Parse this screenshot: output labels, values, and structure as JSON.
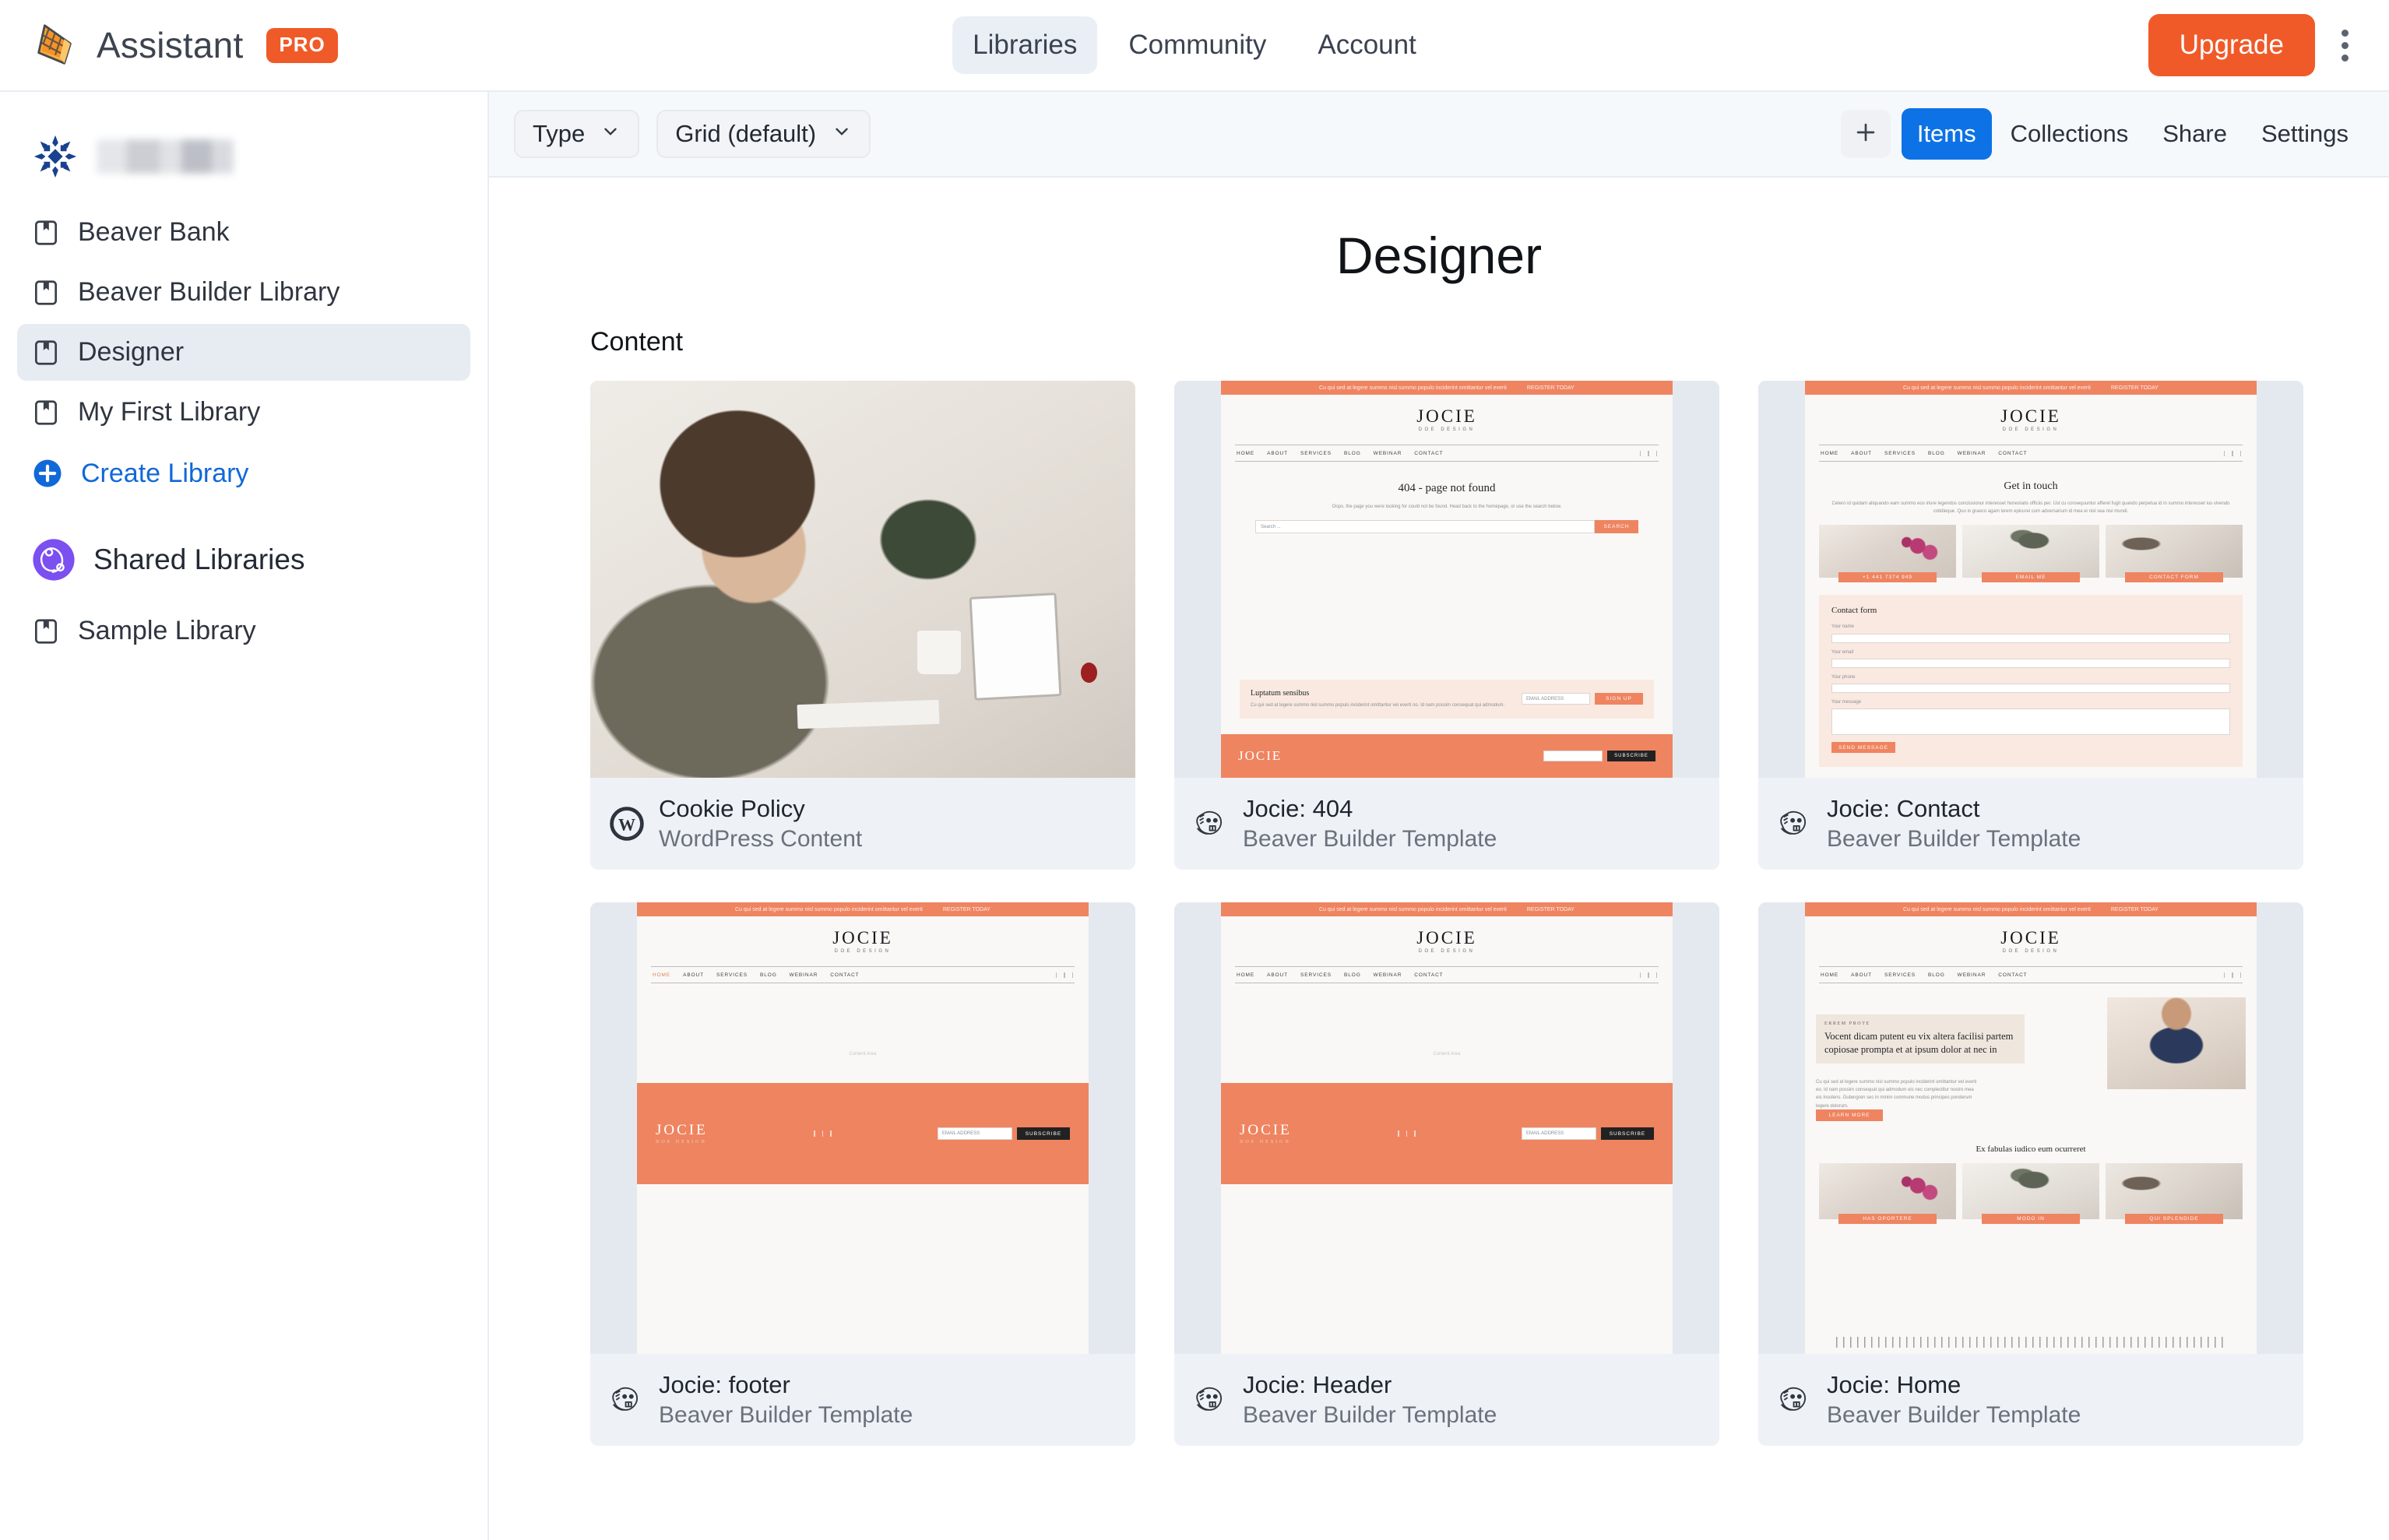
{
  "app": {
    "brand_name": "Assistant",
    "brand_badge": "PRO",
    "logo_icon": "beaver-tail-logo",
    "accent_orange": "#f05a28",
    "accent_blue": "#0d72e6",
    "link_blue": "#1168d8",
    "shared_purple": "#7b4ff0"
  },
  "topnav": {
    "items": [
      {
        "label": "Libraries",
        "active": true
      },
      {
        "label": "Community",
        "active": false
      },
      {
        "label": "Account",
        "active": false
      }
    ],
    "upgrade_label": "Upgrade",
    "kebab_icon": "more-vertical-icon"
  },
  "sidebar": {
    "team": {
      "logo_icon": "snowflake-team-logo",
      "name_redacted": true
    },
    "libraries": [
      {
        "label": "Beaver Bank",
        "icon": "library-bookmark-icon",
        "active": false
      },
      {
        "label": "Beaver Builder Library",
        "icon": "library-bookmark-icon",
        "active": false
      },
      {
        "label": "Designer",
        "icon": "library-bookmark-icon",
        "active": true
      },
      {
        "label": "My First Library",
        "icon": "library-bookmark-icon",
        "active": false
      }
    ],
    "create_label": "Create Library",
    "create_icon": "plus-circle-icon",
    "shared": {
      "heading": "Shared Libraries",
      "avatar_icon": "shared-libraries-avatar",
      "items": [
        {
          "label": "Sample Library",
          "icon": "library-bookmark-icon"
        }
      ]
    }
  },
  "toolbar": {
    "filters": [
      {
        "label": "Type",
        "icon": "chevron-down-icon"
      },
      {
        "label": "Grid (default)",
        "icon": "chevron-down-icon"
      }
    ],
    "add_icon": "plus-icon",
    "tabs": [
      {
        "label": "Items",
        "active": true
      },
      {
        "label": "Collections",
        "active": false
      },
      {
        "label": "Share",
        "active": false
      },
      {
        "label": "Settings",
        "active": false
      }
    ]
  },
  "main": {
    "page_title": "Designer",
    "section_label": "Content",
    "items": [
      {
        "title": "Cookie Policy",
        "subtitle": "WordPress Content",
        "icon": "wordpress-icon",
        "preview": "photo"
      },
      {
        "title": "Jocie: 404",
        "subtitle": "Beaver Builder Template",
        "icon": "beaver-builder-icon",
        "preview": "site-404"
      },
      {
        "title": "Jocie: Contact",
        "subtitle": "Beaver Builder Template",
        "icon": "beaver-builder-icon",
        "preview": "site-contact"
      },
      {
        "title": "Jocie: footer",
        "subtitle": "Beaver Builder Template",
        "icon": "beaver-builder-icon",
        "preview": "site-footer"
      },
      {
        "title": "Jocie: Header",
        "subtitle": "Beaver Builder Template",
        "icon": "beaver-builder-icon",
        "preview": "site-header"
      },
      {
        "title": "Jocie: Home",
        "subtitle": "Beaver Builder Template",
        "icon": "beaver-builder-icon",
        "preview": "site-home"
      }
    ]
  },
  "preview_site": {
    "announce_text": "Cu qui sed at legere summo nisl summo populo inciderint omittantur vel everti",
    "announce_cta": "REGISTER TODAY",
    "logo_main": "JOCIE",
    "logo_sub": "DOE DESIGN",
    "nav": [
      "HOME",
      "ABOUT",
      "SERVICES",
      "BLOG",
      "WEBINAR",
      "CONTACT"
    ],
    "p404": {
      "heading": "404 - page not found",
      "body": "Oops, the page you were looking for could not be found. Head back to the homepage, or use the search below.",
      "search_placeholder": "Search ...",
      "search_button": "SEARCH",
      "newsletter_heading": "Luptatum sensibus",
      "newsletter_body": "Cu qui sed at legere summo nisl summo populo inciderint omittantur vel everti no. Id nam possim consequat qui admodum.",
      "newsletter_placeholder": "EMAIL ADDRESS",
      "newsletter_button": "SIGN UP"
    },
    "contact": {
      "heading": "Get in touch",
      "body": "Cetero id quidam aliquando eam summo eos iriure legendos conclusionur interesset honestatis officiis per. Ust cu consequuntur afferet fugit quando perpetua id in summo interesset ius vivendo cotidieque. Quo in graeco agam lorem epicurei cum adversarium id mea ei nisl sea nisl mundi.",
      "cards": [
        "+1 441 7374 949",
        "EMAIL ME",
        "CONTACT FORM"
      ],
      "form_heading": "Contact form",
      "form_fields": [
        "Your name",
        "Your email",
        "Your phone",
        "Your message"
      ],
      "form_button": "SEND MESSAGE"
    },
    "layout": {
      "content_area_label": "Content Area",
      "footer_placeholder": "EMAIL ADDRESS",
      "footer_button": "SUBSCRIBE"
    },
    "home": {
      "eyebrow": "ERREM PROTE",
      "heading": "Vocent dicam putent eu vix altera facilisi partem copiosae prompta et at ipsum dolor at nec in",
      "body": "Cu qui sed at legere summo nisl summo populo inciderint omittantur vel everti eo. Id nam possim consequat qui admodum eis nec complectitur nostro mea eis insolens. Gubergren sec in minim commune modus principes ponderum legere dolorum.",
      "cta": "LEARN MORE",
      "section_heading": "Ex fabulas iudico eum ocurreret",
      "card_buttons": [
        "HAS OPORTERE",
        "MODO IN",
        "QUI SPLENDIDE"
      ]
    }
  }
}
